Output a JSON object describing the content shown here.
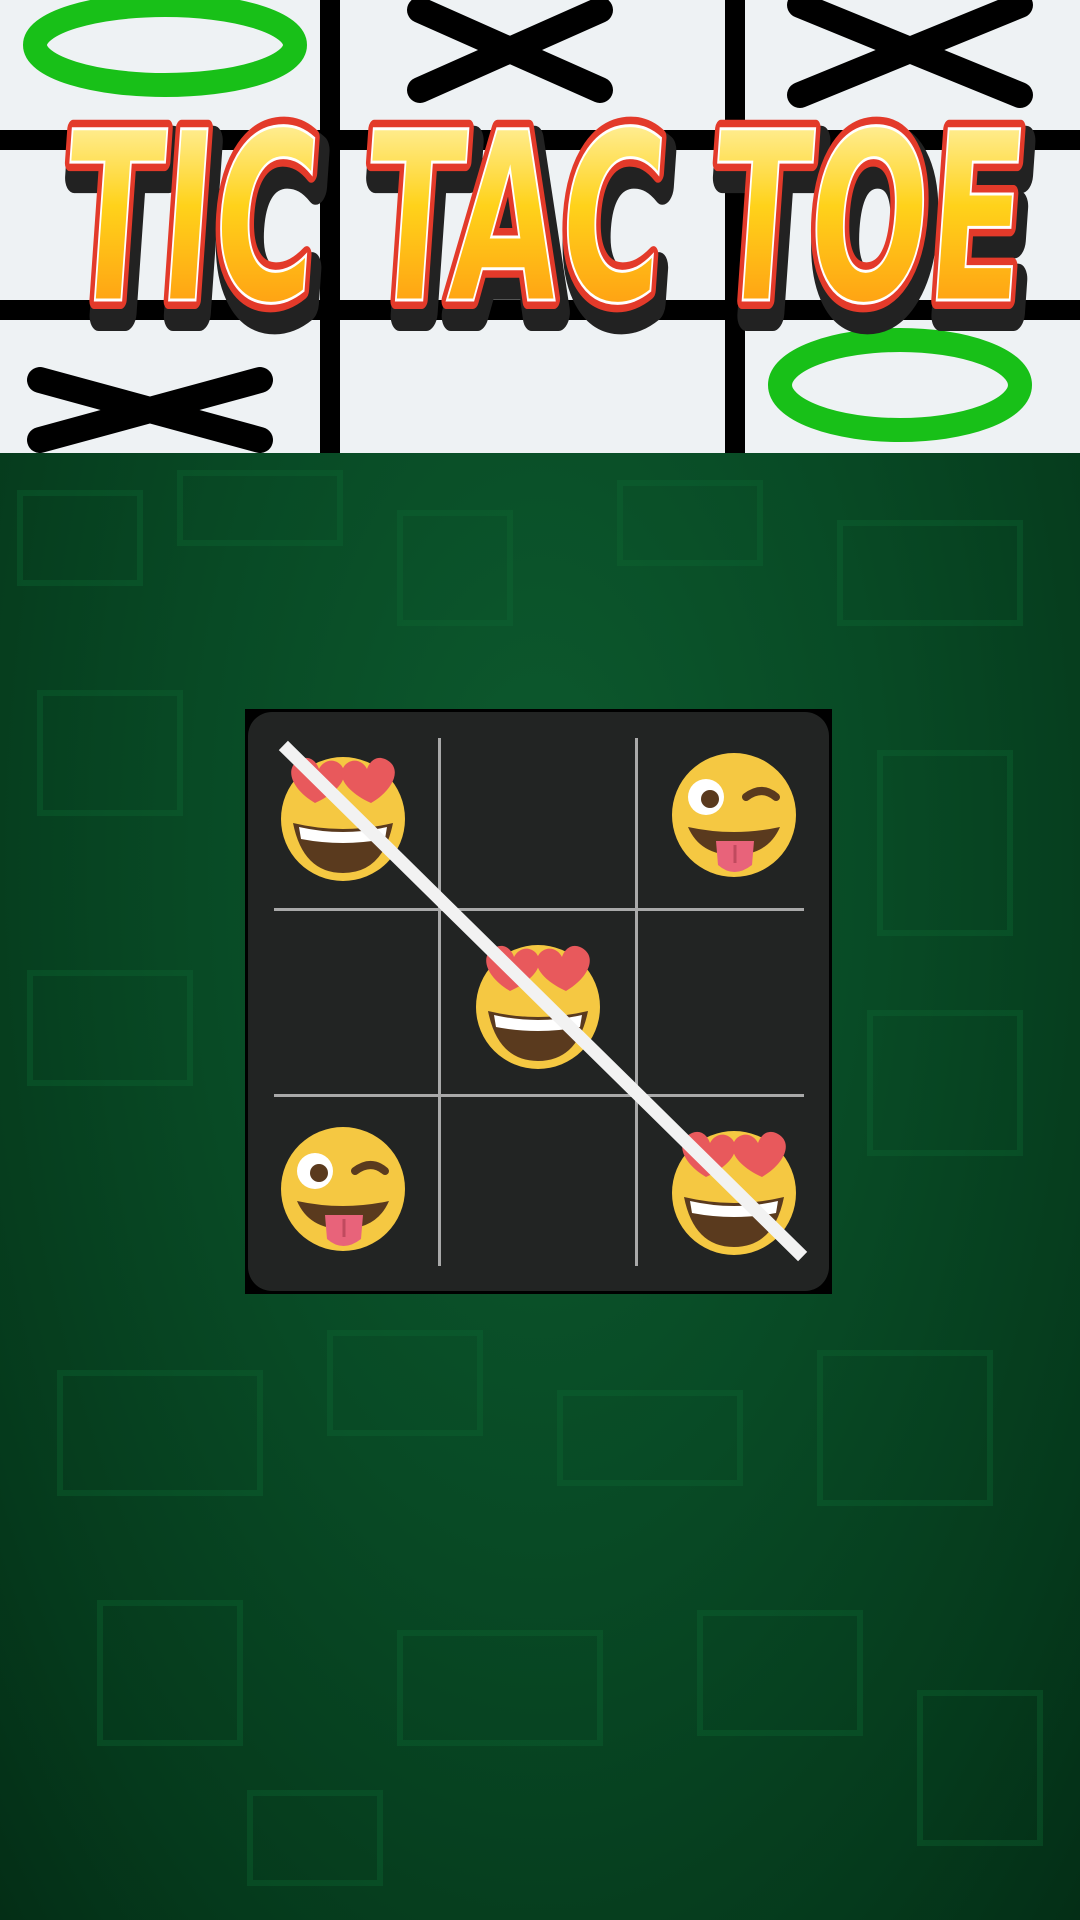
{
  "banner": {
    "title": "TIC TAC TOE"
  },
  "board": {
    "cells": [
      {
        "row": 0,
        "col": 0,
        "mark": "heart-eyes"
      },
      {
        "row": 0,
        "col": 1,
        "mark": ""
      },
      {
        "row": 0,
        "col": 2,
        "mark": "wink-tongue"
      },
      {
        "row": 1,
        "col": 0,
        "mark": ""
      },
      {
        "row": 1,
        "col": 1,
        "mark": "heart-eyes"
      },
      {
        "row": 1,
        "col": 2,
        "mark": ""
      },
      {
        "row": 2,
        "col": 0,
        "mark": "wink-tongue"
      },
      {
        "row": 2,
        "col": 1,
        "mark": ""
      },
      {
        "row": 2,
        "col": 2,
        "mark": "heart-eyes"
      }
    ],
    "winning_line": "diagonal-top-left-to-bottom-right",
    "winner": "heart-eyes"
  },
  "colors": {
    "background_green": "#084a25",
    "board_bg": "#222423",
    "grid": "#a9a9a9",
    "win_line": "#f2f2f2",
    "emoji_face": "#f5c842",
    "heart": "#e8595c"
  }
}
